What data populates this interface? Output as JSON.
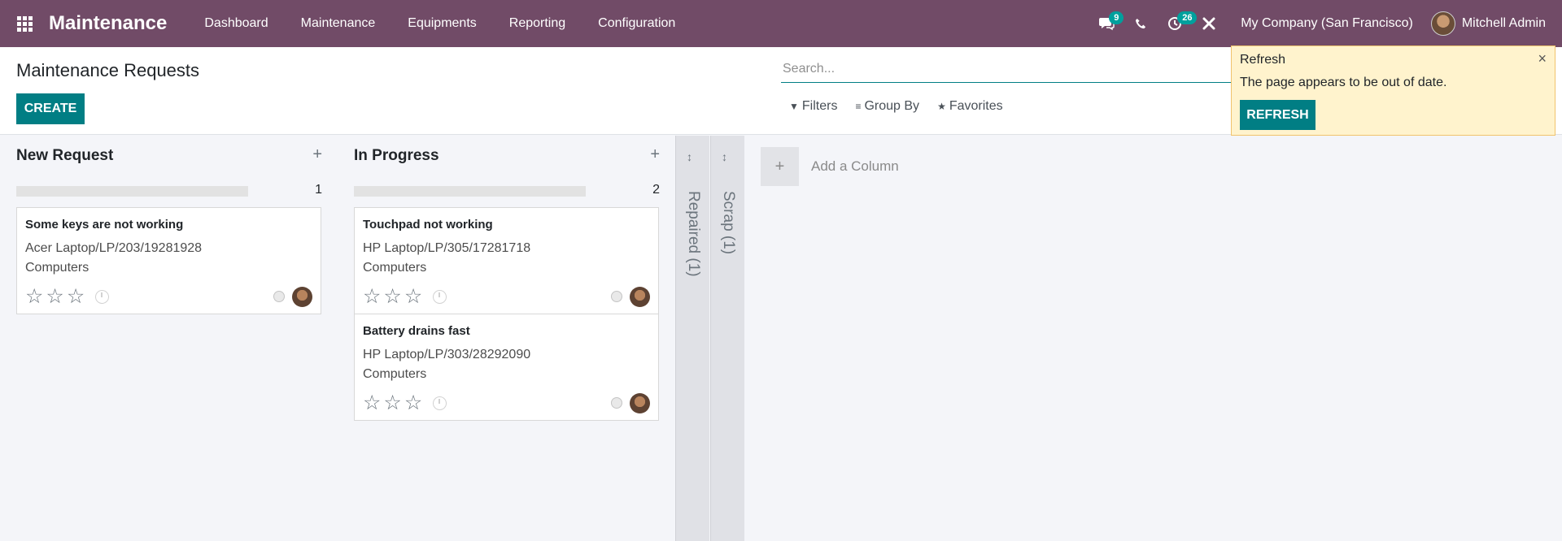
{
  "navbar": {
    "brand": "Maintenance",
    "apps_icon": "grid-icon",
    "menu": [
      "Dashboard",
      "Maintenance",
      "Equipments",
      "Reporting",
      "Configuration"
    ],
    "messages_badge": "9",
    "activities_badge": "26",
    "company": "My Company (San Francisco)",
    "user": "Mitchell Admin",
    "accent_color": "#714b67"
  },
  "control_panel": {
    "title": "Maintenance Requests",
    "create_label": "CREATE",
    "search_placeholder": "Search...",
    "filters_label": "Filters",
    "groupby_label": "Group By",
    "favorites_label": "Favorites"
  },
  "kanban": {
    "columns": [
      {
        "title": "New Request",
        "count": "1",
        "cards": [
          {
            "title": "Some keys are not working",
            "equipment": "Acer Laptop/LP/203/19281928",
            "category": "Computers"
          }
        ]
      },
      {
        "title": "In Progress",
        "count": "2",
        "cards": [
          {
            "title": "Touchpad not working",
            "equipment": "HP Laptop/LP/305/17281718",
            "category": "Computers"
          },
          {
            "title": "Battery drains fast",
            "equipment": "HP Laptop/LP/303/28292090",
            "category": "Computers"
          }
        ]
      }
    ],
    "folded": [
      {
        "label": "Repaired (1)"
      },
      {
        "label": "Scrap (1)"
      }
    ],
    "add_column_label": "Add a Column"
  },
  "notification": {
    "title": "Refresh",
    "message": "The page appears to be out of date.",
    "button": "REFRESH",
    "close": "×"
  },
  "colors": {
    "primary_button": "#017e84",
    "notification_bg": "#fff3cd"
  }
}
